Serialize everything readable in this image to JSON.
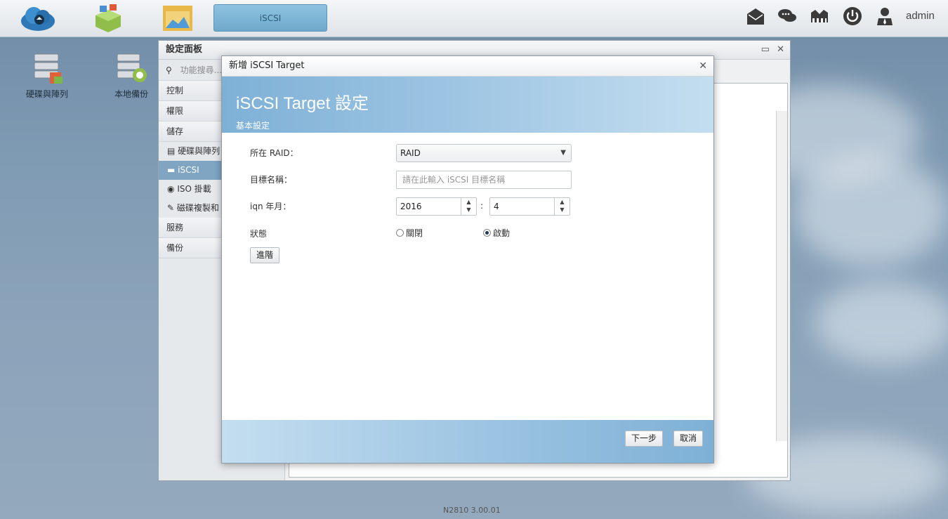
{
  "topbar": {
    "active_tab": "iSCSI",
    "user": "admin",
    "icons": [
      "cloud-backup-icon",
      "app-store-icon",
      "file-manager-icon",
      "mail-icon",
      "chat-icon",
      "network-icon",
      "power-icon",
      "user-icon"
    ]
  },
  "desktop": {
    "items": [
      {
        "label": "硬碟與陣列",
        "icon": "disk-array-icon"
      },
      {
        "label": "本地備份",
        "icon": "local-backup-icon"
      }
    ]
  },
  "settings_window": {
    "title": "設定面板",
    "search_placeholder": "功能搜尋...",
    "categories": [
      "控制",
      "權限",
      "儲存",
      "服務",
      "備份"
    ],
    "storage_items": [
      {
        "label": "硬碟與陣列",
        "icon": "disk-array-icon"
      },
      {
        "label": "iSCSI",
        "icon": "iscsi-icon",
        "selected": true
      },
      {
        "label": "ISO 掛載",
        "icon": "iso-icon"
      },
      {
        "label": "磁碟複製和",
        "icon": "clone-icon"
      }
    ]
  },
  "dialog": {
    "title": "新增 iSCSI Target",
    "heading": "iSCSI Target 設定",
    "subheading": "基本設定",
    "labels": {
      "raid": "所在 RAID：",
      "target_name": "目標名稱：",
      "iqn": "iqn 年月：",
      "status": "狀態"
    },
    "raid_value": "RAID",
    "target_name_placeholder": "請在此輸入 iSCSI 目標名稱",
    "iqn_year": "2016",
    "iqn_month": "4",
    "colon": ":",
    "status_options": [
      {
        "label": "關閉",
        "selected": false
      },
      {
        "label": "啟動",
        "selected": true
      }
    ],
    "advanced_button": "進階",
    "next_button": "下一步",
    "cancel_button": "取消"
  },
  "footer": {
    "version": "N2810   3.00.01"
  }
}
